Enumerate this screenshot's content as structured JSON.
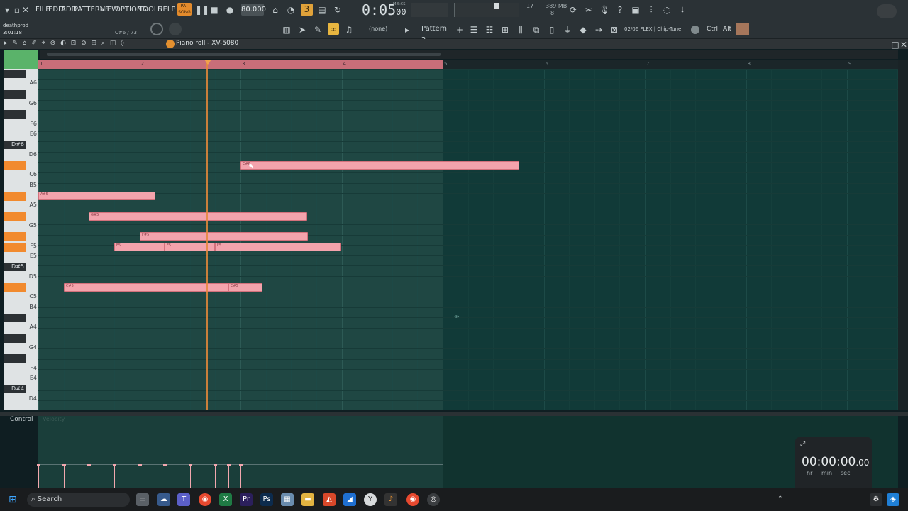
{
  "menu": [
    "FILE",
    "EDIT",
    "ADD",
    "PATTERNS",
    "VIEW",
    "OPTIONS",
    "TOOLS",
    "HELP"
  ],
  "toolbar": {
    "tempo": "80.000",
    "time": "0:05",
    "time_frac": "00",
    "time_unit": "M:S:CS",
    "cpu": "17",
    "memory": "389 MB",
    "memory2": "8"
  },
  "project": {
    "name": "deathprod",
    "time": "3:01:18",
    "hint": "C#6 / 73"
  },
  "toolbar2": {
    "channel": "(none)",
    "pattern": "Pattern 2",
    "plugin": "02/06 FLEX | Chip-Tune",
    "ctrl": "Ctrl",
    "alt": "Alt"
  },
  "pianoroll": {
    "title": "Piano roll - XV-5080",
    "bars": [
      "1",
      "2",
      "3",
      "4",
      "5",
      "6",
      "7",
      "8",
      "9"
    ]
  },
  "keys": [
    {
      "label": "A6",
      "row": 0
    },
    {
      "label": "G6",
      "row": 2
    },
    {
      "label": "F6",
      "row": 4
    },
    {
      "label": "E6",
      "row": 5
    },
    {
      "label": "D#6",
      "row": 6,
      "black": true
    },
    {
      "label": "D6",
      "row": 7
    },
    {
      "label": "C6",
      "row": 9
    },
    {
      "label": "B5",
      "row": 10
    },
    {
      "label": "A5",
      "row": 12
    },
    {
      "label": "G5",
      "row": 14
    },
    {
      "label": "F5",
      "row": 16
    },
    {
      "label": "E5",
      "row": 17
    },
    {
      "label": "D#5",
      "row": 18,
      "black": true
    },
    {
      "label": "D5",
      "row": 19
    },
    {
      "label": "C5",
      "row": 21
    },
    {
      "label": "B4",
      "row": 22
    },
    {
      "label": "A4",
      "row": 24
    },
    {
      "label": "G4",
      "row": 26
    },
    {
      "label": "F4",
      "row": 28
    },
    {
      "label": "E4",
      "row": 29
    },
    {
      "label": "D#4",
      "row": 30,
      "black": true
    },
    {
      "label": "D4",
      "row": 31
    }
  ],
  "notes": [
    {
      "label": "C#6",
      "pitch": "C#6",
      "start": 1.0,
      "length": 1.38
    },
    {
      "label": "A#5",
      "pitch": "A#5",
      "start": 0.0,
      "length": 0.58
    },
    {
      "label": "G#5",
      "pitch": "G#5",
      "start": 0.25,
      "length": 1.08
    },
    {
      "label": "F#5",
      "pitch": "F#5",
      "start": 0.5,
      "length": 0.83
    },
    {
      "label": "F5",
      "pitch": "F5",
      "start": 0.375,
      "length": 0.25
    },
    {
      "label": "F5",
      "pitch": "F5",
      "start": 0.625,
      "length": 0.25
    },
    {
      "label": "F5",
      "pitch": "F5",
      "start": 0.875,
      "length": 0.625
    },
    {
      "label": "C#5",
      "pitch": "C#5",
      "start": 0.125,
      "length": 0.83
    },
    {
      "label": "C#5",
      "pitch": "C#5",
      "start": 0.94,
      "length": 0.17
    }
  ],
  "control": {
    "label": "Control",
    "param": "Velocity"
  },
  "timer": {
    "value": "00:00:00",
    "frac": ".00",
    "units": [
      "hr",
      "min",
      "sec"
    ]
  },
  "taskbar": {
    "search": "Search"
  }
}
